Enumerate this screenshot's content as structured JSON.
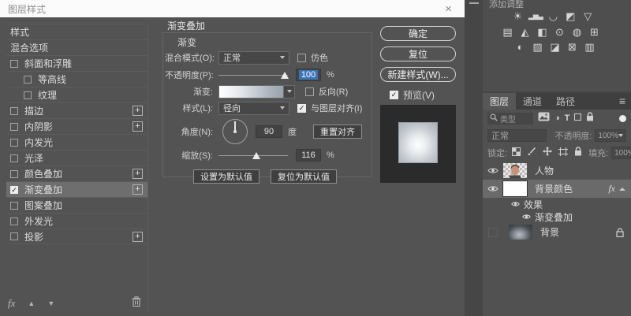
{
  "glyphs": {
    "check": "✓",
    "close": "×",
    "plus": "+",
    "up": "▲",
    "down": "▼",
    "menu": "≡",
    "half_circle": "◑",
    "type": "T"
  },
  "dialog": {
    "title": "图层样式",
    "sidebar": {
      "items": [
        {
          "label": "样式"
        },
        {
          "label": "混合选项"
        },
        {
          "label": "斜面和浮雕"
        },
        {
          "label": "等高线"
        },
        {
          "label": "纹理"
        },
        {
          "label": "描边"
        },
        {
          "label": "内阴影"
        },
        {
          "label": "内发光"
        },
        {
          "label": "光泽"
        },
        {
          "label": "颜色叠加"
        },
        {
          "label": "渐变叠加"
        },
        {
          "label": "图案叠加"
        },
        {
          "label": "外发光"
        },
        {
          "label": "投影"
        }
      ],
      "fx": "fx"
    },
    "panel": {
      "title": "渐变叠加",
      "group_label": "渐变",
      "blend_mode_label": "混合模式(O):",
      "blend_mode_value": "正常",
      "dither_label": "仿色",
      "opacity_label": "不透明度(P):",
      "opacity_value": "100",
      "opacity_unit": "%",
      "gradient_label": "渐变:",
      "reverse_label": "反向(R)",
      "style_label": "样式(L):",
      "style_value": "径向",
      "align_label": "与图层对齐(I)",
      "angle_label": "角度(N):",
      "angle_value": "90",
      "angle_unit": "度",
      "reset_align_label": "重置对齐",
      "scale_label": "缩放(S):",
      "scale_value": "116",
      "scale_unit": "%",
      "set_default_label": "设置为默认值",
      "reset_default_label": "复位为默认值"
    },
    "actions": {
      "ok": "确定",
      "reset": "复位",
      "new_style": "新建样式(W)...",
      "preview": "预览(V)"
    }
  },
  "adjustments": {
    "title": "添加调整",
    "icons": [
      {
        "name": "brightness-contrast",
        "glyph": "☀"
      },
      {
        "name": "levels",
        "glyph": "▂▅▃"
      },
      {
        "name": "curves",
        "glyph": "◡"
      },
      {
        "name": "exposure",
        "glyph": "◩"
      },
      {
        "name": "vibrance",
        "glyph": "▽"
      },
      {
        "name": "hue-saturation",
        "glyph": "▤"
      },
      {
        "name": "color-balance",
        "glyph": "◭"
      },
      {
        "name": "black-white",
        "glyph": "◧"
      },
      {
        "name": "photo-filter",
        "glyph": "⊙"
      },
      {
        "name": "channel-mixer",
        "glyph": "◍"
      },
      {
        "name": "color-lookup",
        "glyph": "⊞"
      },
      {
        "name": "invert",
        "glyph": "◐"
      },
      {
        "name": "posterize",
        "glyph": "▨"
      },
      {
        "name": "threshold",
        "glyph": "◪"
      },
      {
        "name": "selective-color",
        "glyph": "⊠"
      },
      {
        "name": "gradient-map",
        "glyph": "▥"
      }
    ]
  },
  "layers_panel": {
    "tabs": [
      "图层",
      "通道",
      "路径"
    ],
    "filter": {
      "kind_label": "类型"
    },
    "blend": {
      "mode": "正常",
      "opacity_label": "不透明度:",
      "opacity_value": "100%"
    },
    "lock": {
      "label": "锁定:",
      "fill_label": "填充:",
      "fill_value": "100%"
    },
    "layers": [
      {
        "name": "人物"
      },
      {
        "name": "背景颜色",
        "fx": "fx"
      },
      {
        "name": "效果"
      },
      {
        "name": "渐变叠加"
      },
      {
        "name": "背景"
      }
    ]
  }
}
